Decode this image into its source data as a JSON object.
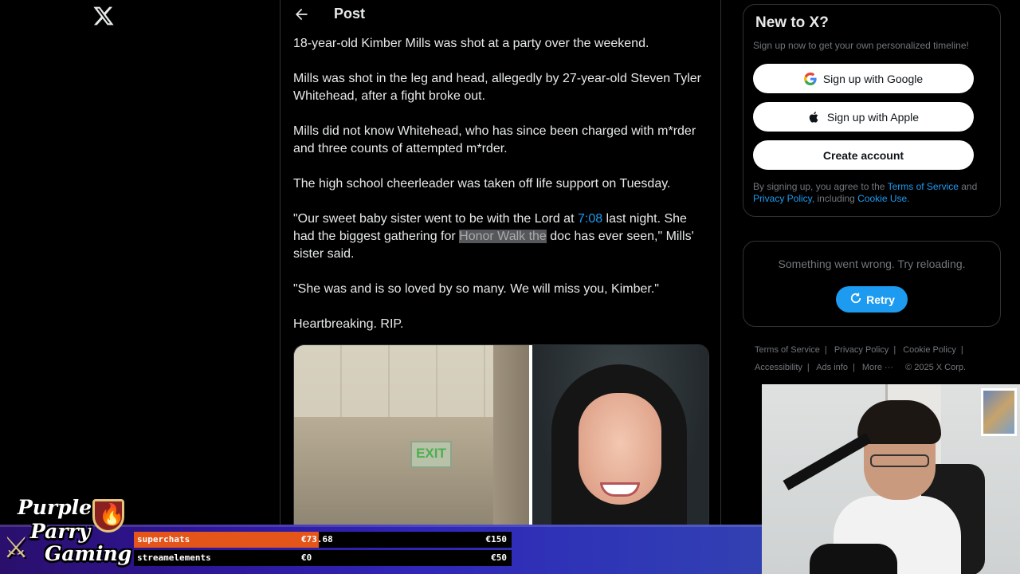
{
  "nav": {
    "logo_icon": "x-logo-icon"
  },
  "post": {
    "header_title": "Post",
    "back_icon": "arrow-left-icon",
    "paragraphs": {
      "p1": "18-year-old Kimber Mills was shot at a party over the weekend.",
      "p2": "Mills was shot in the leg and head, allegedly by 27-year-old Steven Tyler Whitehead, after a fight broke out.",
      "p3": "Mills did not know Whitehead, who has since been charged with m*rder and three counts of attempted m*rder.",
      "p4": "The high school cheerleader was taken off life support on Tuesday.",
      "p5_a": "\"Our sweet baby sister went to be with the Lord at ",
      "p5_link": "7:08",
      "p5_b": " last night. She had the biggest gathering for ",
      "p5_highlight": "Honor Walk the",
      "p5_c": " doc has ever seen,\" Mills' sister said.",
      "p6": "\"She was and is so loved by so many. We will miss you, Kimber.\"",
      "p7": "Heartbreaking. RIP."
    },
    "media": {
      "sign_text": "EXIT"
    }
  },
  "signup": {
    "title": "New to X?",
    "subtitle": "Sign up now to get your own personalized timeline!",
    "google_label": "Sign up with Google",
    "apple_label": "Sign up with Apple",
    "create_label": "Create account",
    "legal_a": "By signing up, you agree to the ",
    "terms_link": "Terms of Service",
    "legal_b": " and ",
    "privacy_link": "Privacy Policy",
    "legal_c": ", including ",
    "cookie_link": "Cookie Use",
    "legal_d": "."
  },
  "error_card": {
    "message": "Something went wrong. Try reloading.",
    "retry_label": "Retry"
  },
  "footer": {
    "terms": "Terms of Service",
    "privacy": "Privacy Policy",
    "cookie": "Cookie Policy",
    "accessibility": "Accessibility",
    "ads": "Ads info",
    "more": "More ···",
    "copyright": "© 2025 X Corp.",
    "separator": "|"
  },
  "stream": {
    "logo": {
      "line1": "Purple",
      "line2": "Parry",
      "line3": "Gaming"
    },
    "goals": [
      {
        "label": "superchats",
        "current": "€73.68",
        "max": "€150",
        "progress": 0.49
      },
      {
        "label": "streamelements",
        "current": "€0",
        "max": "€50",
        "progress": 0
      }
    ]
  },
  "colors": {
    "accent": "#1d9bf0",
    "background": "#000000",
    "goal_fill": "#e4551a"
  }
}
